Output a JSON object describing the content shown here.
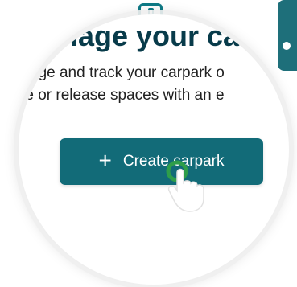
{
  "background": {
    "heading_fragment": "ge your ca"
  },
  "lens": {
    "heading": "nage your car",
    "description_line_1": "age and track your carpark o",
    "description_line_2": "erve or release spaces with an e"
  },
  "create_button": {
    "label": "Create carpark",
    "icon": "plus-icon"
  },
  "colors": {
    "accent": "#126b78",
    "heading": "#083b4a",
    "click_ring": "#2e9e4a"
  }
}
